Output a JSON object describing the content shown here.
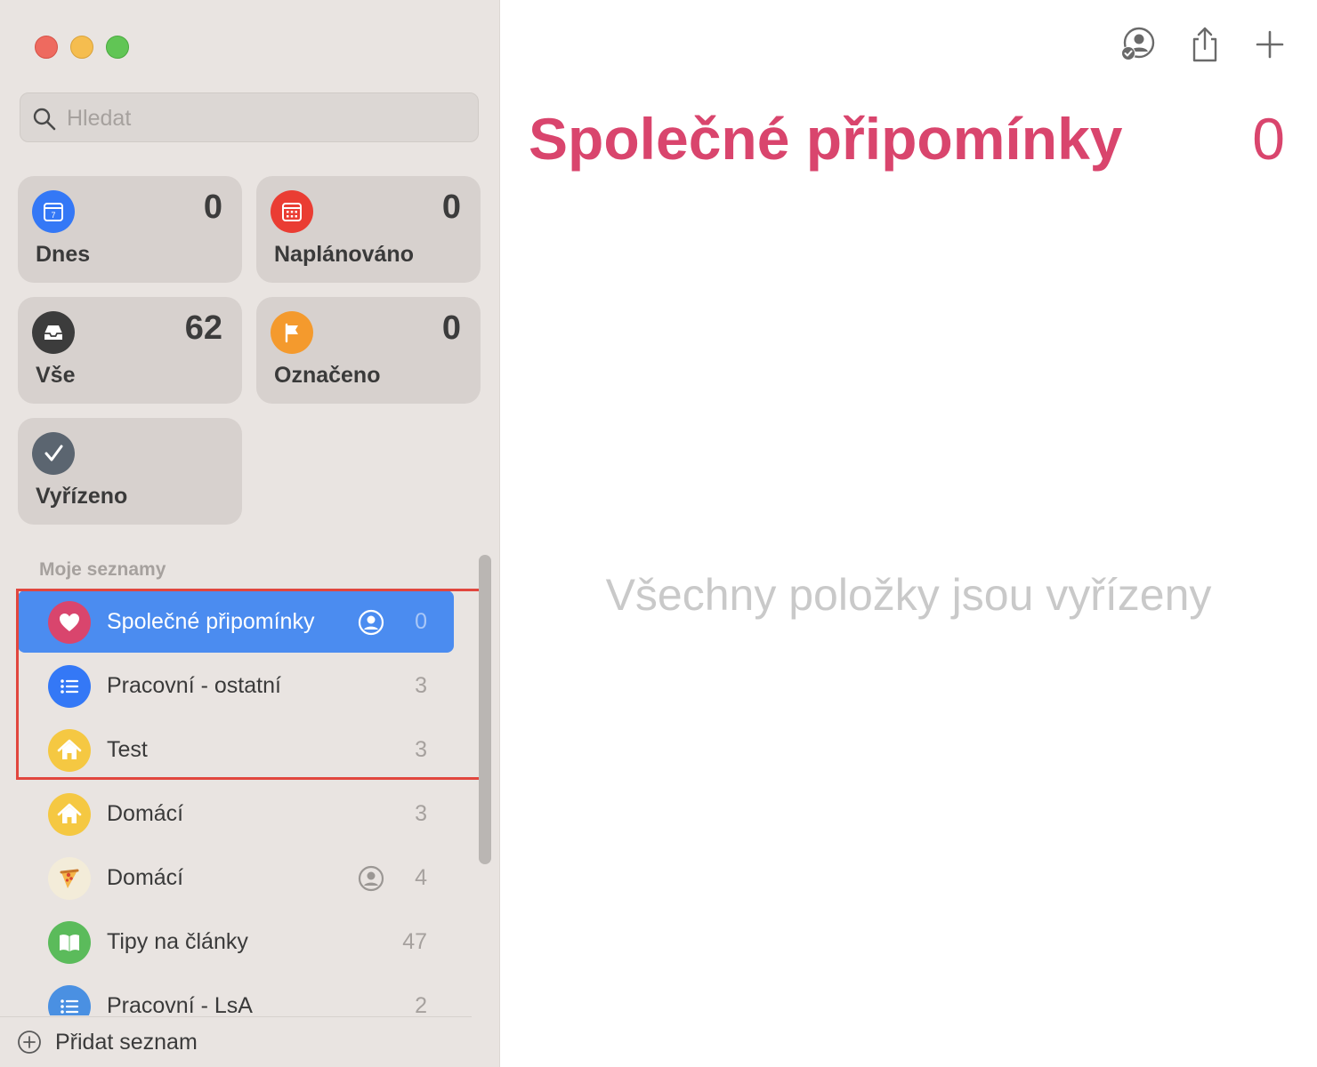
{
  "window": {
    "controls": [
      "close",
      "minimize",
      "zoom"
    ]
  },
  "search": {
    "placeholder": "Hledat",
    "value": ""
  },
  "smart_lists": [
    {
      "label": "Dnes",
      "count": "0",
      "icon": "calendar-icon",
      "color": "#3478f6",
      "calendar_day": "7"
    },
    {
      "label": "Naplánováno",
      "count": "0",
      "icon": "calendar-grid-icon",
      "color": "#ea3d33"
    },
    {
      "label": "Vše",
      "count": "62",
      "icon": "tray-icon",
      "color": "#3c3c3c"
    },
    {
      "label": "Označeno",
      "count": "0",
      "icon": "flag-icon",
      "color": "#f49a2d"
    },
    {
      "label": "Vyřízeno",
      "count": "",
      "icon": "checkmark-icon",
      "color": "#5b6570"
    }
  ],
  "my_lists": {
    "title": "Moje seznamy",
    "items": [
      {
        "name": "Společné připomínky",
        "count": "0",
        "icon": "heart-icon",
        "color": "#d9456d",
        "shared": true,
        "selected": true
      },
      {
        "name": "Pracovní - ostatní",
        "count": "3",
        "icon": "list-bullet-icon",
        "color": "#3478f6",
        "shared": false
      },
      {
        "name": "Test",
        "count": "3",
        "icon": "house-icon",
        "color": "#f5c842",
        "shared": false
      },
      {
        "name": "Domácí",
        "count": "3",
        "icon": "house-icon",
        "color": "#f5c842",
        "shared": false
      },
      {
        "name": "Domácí",
        "count": "4",
        "icon": "pizza-icon",
        "color": "#f3ecd9",
        "shared": true
      },
      {
        "name": "Tipy na články",
        "count": "47",
        "icon": "book-icon",
        "color": "#5bbb5b",
        "shared": false
      },
      {
        "name": "Pracovní - LsA",
        "count": "2",
        "icon": "list-bullet-icon",
        "color": "#4a90e2",
        "shared": false
      }
    ]
  },
  "footer": {
    "add_list_label": "Přidat seznam"
  },
  "toolbar": {
    "icons": [
      "share-with-people-icon",
      "share-icon",
      "plus-icon"
    ]
  },
  "main": {
    "title": "Společné připomínky",
    "count": "0",
    "empty_message": "Všechny položky jsou vyřízeny",
    "accent": "#d9456d"
  },
  "annotation": {
    "highlight_color": "#e1463e"
  }
}
